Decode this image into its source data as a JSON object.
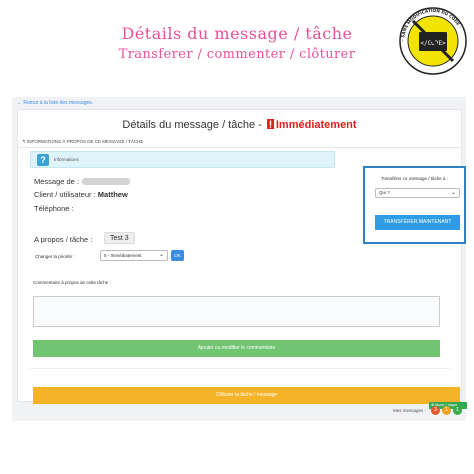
{
  "hero": {
    "title": "Détails du message / tâche",
    "subtitle": "Transferer / commenter / clôturer"
  },
  "badge": {
    "ring_text": "· SANS MODIFICATION DU CODE ·",
    "code_label": "</CODE>"
  },
  "app": {
    "back_link": "← Retour à la liste des messages.",
    "title_prefix": "Détails du message / tâche - ",
    "urgency": "Immédiatement",
    "section_header": "↰ INFORMATIONS À PROPOS DE CE MESSAGE / TÂCHE.",
    "info_label": "Informations",
    "message_from_label": "Message de :",
    "client_label": "Client / utilisateur :",
    "client_value": "Matthew",
    "phone_label": "Téléphone :",
    "about_label": "A propos / tâche :",
    "about_value": "Test 3",
    "priority_label": "Changer la priorité :",
    "priority_value": "5 - Immédiatement",
    "ok_label": "OK",
    "comment_label": "Commentaire à propos de cette tâche :",
    "comment_value": "",
    "save_comment_label": "Ajouter ou modifier le commentaire",
    "close_task_label": "Clôturer la tâche / message",
    "task_badge": "⊕ tâche / rappe"
  },
  "transfer": {
    "label": "Transférer ce message / tâche à :",
    "select_value": "Qui ?",
    "button_label": "TRANSFÉRER MAINTENANT"
  },
  "footer": {
    "messages_label": "Mes messages :",
    "counts": [
      "3",
      "1",
      "1"
    ],
    "colors": [
      "#e05a2b",
      "#f0a020",
      "#3aab4a"
    ]
  },
  "colors": {
    "accent_pink": "#e8509a",
    "transfer_border": "#2f7fc1",
    "primary_blue": "#2e9de6",
    "success_green": "#71c472",
    "warning_orange": "#f5b32a",
    "urgent_red": "#e02020"
  }
}
